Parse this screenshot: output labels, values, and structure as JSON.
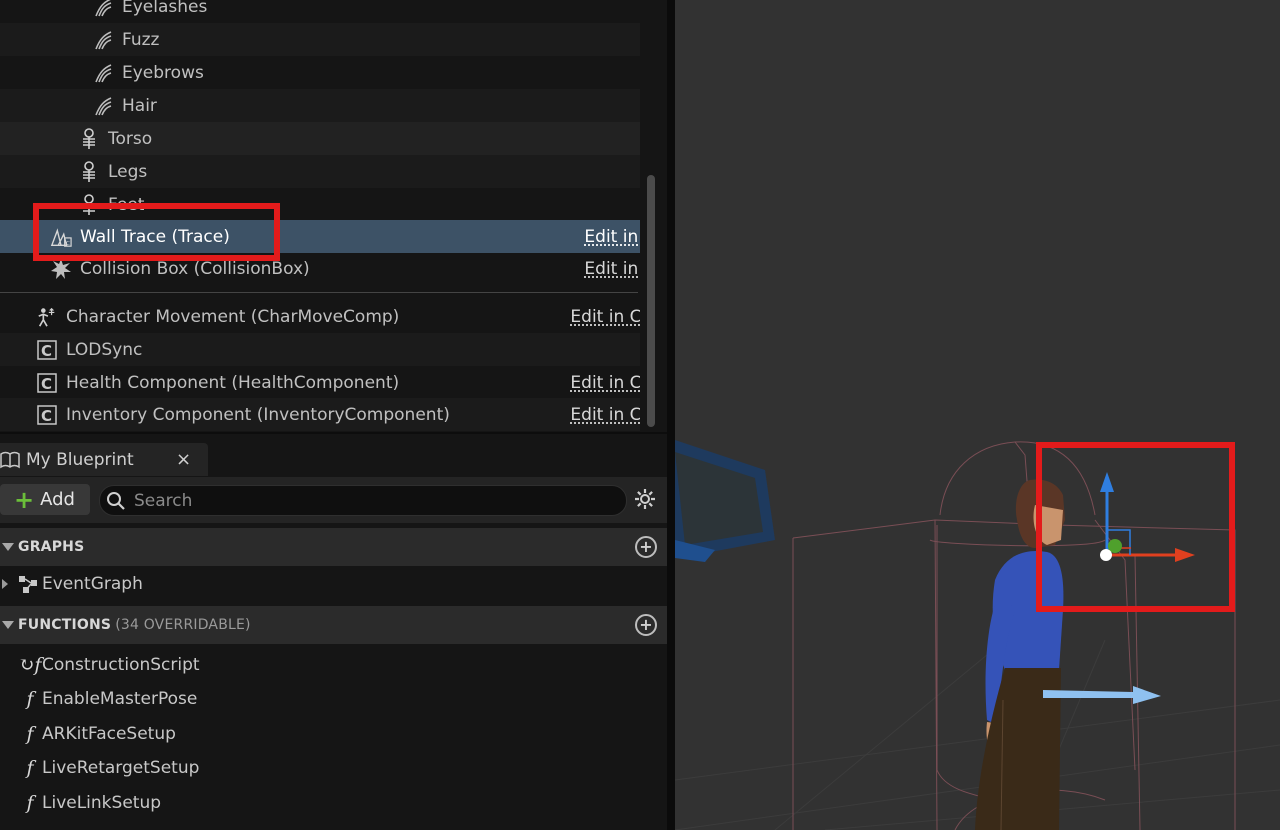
{
  "components": {
    "items": [
      {
        "label": "Eyelashes",
        "icon": "groom-icon",
        "edit": ""
      },
      {
        "label": "Fuzz",
        "icon": "groom-icon",
        "edit": ""
      },
      {
        "label": "Eyebrows",
        "icon": "groom-icon",
        "edit": ""
      },
      {
        "label": "Hair",
        "icon": "groom-icon",
        "edit": ""
      },
      {
        "label": "Torso",
        "icon": "skeletal-mesh-icon",
        "edit": ""
      },
      {
        "label": "Legs",
        "icon": "skeletal-mesh-icon",
        "edit": ""
      },
      {
        "label": "Feet",
        "icon": "skeletal-mesh-icon",
        "edit": ""
      },
      {
        "label": "Wall Trace (Trace)",
        "icon": "trace-icon",
        "edit": "Edit in C++"
      },
      {
        "label": "Collision Box (CollisionBox)",
        "icon": "collision-box-icon",
        "edit": "Edit in C++"
      },
      {
        "label": "Character Movement (CharMoveComp)",
        "icon": "character-movement-icon",
        "edit": "Edit in C++"
      },
      {
        "label": "LODSync",
        "icon": "component-icon",
        "edit": ""
      },
      {
        "label": "Health Component (HealthComponent)",
        "icon": "component-icon",
        "edit": "Edit in C++"
      },
      {
        "label": "Inventory Component (InventoryComponent)",
        "icon": "component-icon",
        "edit": "Edit in C++"
      }
    ]
  },
  "my_blueprint": {
    "tab_title": "My Blueprint",
    "close_label": "×",
    "add_label": "Add",
    "search_placeholder": "Search",
    "graphs": {
      "title": "GRAPHS",
      "items": [
        "EventGraph"
      ]
    },
    "functions": {
      "title": "FUNCTIONS",
      "subtitle": "(34 OVERRIDABLE)",
      "items": [
        "ConstructionScript",
        "EnableMasterPose",
        "ARKitFaceSetup",
        "LiveRetargetSetup",
        "LiveLinkSetup"
      ]
    }
  },
  "colors": {
    "selection": "#3d5266",
    "highlight_red": "#e31b1b",
    "add_green": "#6bbf3a",
    "gizmo_x": "#e0401f",
    "gizmo_y": "#4fa02c",
    "gizmo_z": "#2f7ee0",
    "capsule_arrow": "#8fc1f0"
  }
}
